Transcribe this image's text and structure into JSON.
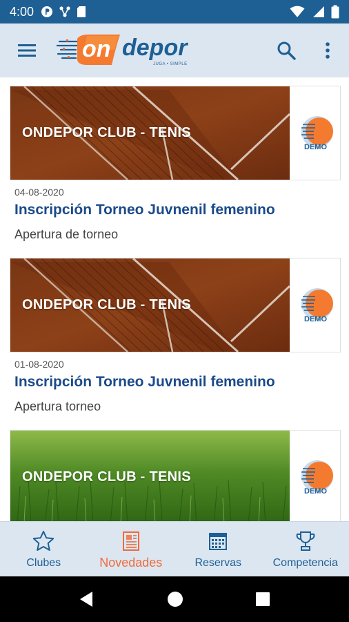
{
  "status_bar": {
    "time": "4:00",
    "icons": [
      "notification-p-icon",
      "share-nodes-icon",
      "sd-card-icon",
      "wifi-icon",
      "signal-icon",
      "battery-icon"
    ]
  },
  "app_bar": {
    "logo_text": "on depor",
    "logo_prefix": "on",
    "logo_suffix": "depor",
    "logo_tagline": "JUGA • SIMPLE",
    "icons": [
      "menu-icon",
      "search-icon",
      "more-vert-icon"
    ]
  },
  "colors": {
    "primary": "#1e5f94",
    "app_bar_bg": "#dce6f1",
    "accent": "#f06a3a",
    "title_blue": "#1b4a8a"
  },
  "feed": {
    "cards": [
      {
        "banner_title": "ONDEPOR CLUB - TENIS",
        "banner_kind": "clay",
        "club_logo_text": "DEMO",
        "date": "04-08-2020",
        "title": "Inscripción Torneo Juvnenil femenino",
        "subtitle": "Apertura de torneo"
      },
      {
        "banner_title": "ONDEPOR CLUB - TENIS",
        "banner_kind": "clay",
        "club_logo_text": "DEMO",
        "date": "01-08-2020",
        "title": "Inscripción Torneo Juvnenil femenino",
        "subtitle": "Apertura torneo"
      },
      {
        "banner_title": "ONDEPOR CLUB - TENIS",
        "banner_kind": "grass",
        "club_logo_text": "DEMO"
      }
    ]
  },
  "bottom_nav": {
    "active": "Novedades",
    "items": [
      {
        "label": "Clubes",
        "icon": "star-icon"
      },
      {
        "label": "Novedades",
        "icon": "newspaper-icon"
      },
      {
        "label": "Reservas",
        "icon": "calendar-icon"
      },
      {
        "label": "Competencia",
        "icon": "trophy-icon"
      }
    ]
  },
  "system_nav": {
    "icons": [
      "back-icon",
      "home-icon",
      "recents-icon"
    ]
  }
}
